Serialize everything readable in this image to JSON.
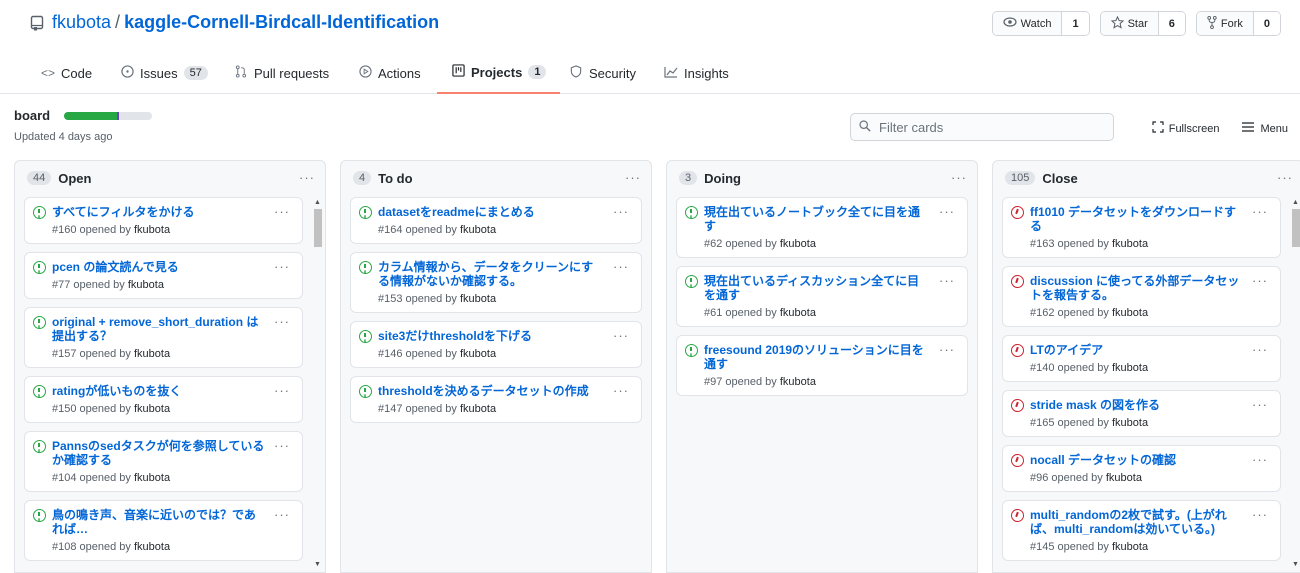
{
  "repo": {
    "owner": "fkubota",
    "slash": "/",
    "name": "kaggle-Cornell-Birdcall-Identification"
  },
  "social": [
    {
      "label": "Watch",
      "count": "1",
      "icon": "eye-icon"
    },
    {
      "label": "Star",
      "count": "6",
      "icon": "star-icon"
    },
    {
      "label": "Fork",
      "count": "0",
      "icon": "fork-icon"
    }
  ],
  "tabs": [
    {
      "label": "Code",
      "icon": "code-icon"
    },
    {
      "label": "Issues",
      "count": "57",
      "icon": "issue-icon"
    },
    {
      "label": "Pull requests",
      "icon": "pull-request-icon"
    },
    {
      "label": "Actions",
      "icon": "play-icon"
    },
    {
      "label": "Projects",
      "count": "1",
      "icon": "project-icon",
      "active": true
    },
    {
      "label": "Security",
      "icon": "shield-icon"
    },
    {
      "label": "Insights",
      "icon": "graph-icon"
    }
  ],
  "project": {
    "name": "board",
    "updated": "Updated 4 days ago",
    "progress": {
      "done_pct": 60,
      "in_progress_pct": 2
    },
    "filter_placeholder": "Filter cards",
    "fullscreen_label": "Fullscreen",
    "menu_label": "Menu"
  },
  "colors": {
    "link": "#0366d6",
    "open": "#28a745",
    "closed": "#cb2431",
    "active_tab": "#f9826c"
  },
  "columns": [
    {
      "count": "44",
      "name": "Open",
      "dots": "···",
      "cards": [
        {
          "title": "すべてにフィルタをかける",
          "num": "#160",
          "state": "open"
        },
        {
          "title": "pcen の論文読んで見る",
          "num": "#77",
          "state": "open"
        },
        {
          "title": "original + remove_short_duration は提出する？",
          "num": "#157",
          "state": "open"
        },
        {
          "title": "ratingが低いものを抜く",
          "num": "#150",
          "state": "open"
        },
        {
          "title": "Pannsのsedタスクが何を参照しているか確認する",
          "num": "#104",
          "state": "open"
        },
        {
          "title": "鳥の鳴き声、音楽に近いのでは？であれば…",
          "num": "#108",
          "state": "open"
        }
      ]
    },
    {
      "count": "4",
      "name": "To do",
      "dots": "···",
      "cards": [
        {
          "title": "datasetをreadmeにまとめる",
          "num": "#164",
          "state": "open"
        },
        {
          "title": "カラム情報から、データをクリーンにする情報がないか確認する。",
          "num": "#153",
          "state": "open"
        },
        {
          "title": "site3だけthresholdを下げる",
          "num": "#146",
          "state": "open"
        },
        {
          "title": "thresholdを決めるデータセットの作成",
          "num": "#147",
          "state": "open"
        }
      ]
    },
    {
      "count": "3",
      "name": "Doing",
      "dots": "···",
      "cards": [
        {
          "title": "現在出ているノートブック全てに目を通す",
          "num": "#62",
          "state": "open"
        },
        {
          "title": "現在出ているディスカッション全てに目を通す",
          "num": "#61",
          "state": "open"
        },
        {
          "title": "freesound 2019のソリューションに目を通す",
          "num": "#97",
          "state": "open"
        }
      ]
    },
    {
      "count": "105",
      "name": "Close",
      "dots": "···",
      "cards": [
        {
          "title": "ff1010 データセットをダウンロードする",
          "num": "#163",
          "state": "closed"
        },
        {
          "title": "discussion に使ってる外部データセットを報告する。",
          "num": "#162",
          "state": "closed"
        },
        {
          "title": "LTのアイデア",
          "num": "#140",
          "state": "closed"
        },
        {
          "title": "stride mask の図を作る",
          "num": "#165",
          "state": "closed"
        },
        {
          "title": "nocall データセットの確認",
          "num": "#96",
          "state": "closed"
        },
        {
          "title": "multi_randomの2枚で試す。(上がれば、multi_randomは効いている。)",
          "num": "#145",
          "state": "closed"
        }
      ]
    }
  ],
  "card_meta": {
    "opened_by": "opened by",
    "author": "fkubota"
  },
  "card_dots": "···"
}
